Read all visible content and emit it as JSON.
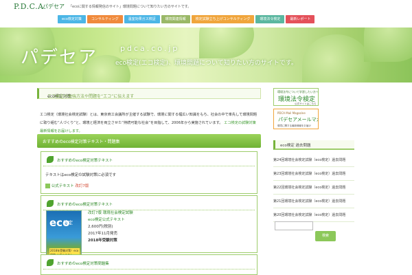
{
  "header": {
    "logo": "P.D.C.A.",
    "logo_sub": "パデセア",
    "tagline": "「ecoに関する情報発信のサイト」環境問題について知りたい方のサイトです。"
  },
  "nav": [
    {
      "label": "eco検定対策",
      "color": "#4cb6e6"
    },
    {
      "label": "コンサルティング",
      "color": "#f08a3c"
    },
    {
      "label": "温室効果ガス検証",
      "color": "#4cb6e6"
    },
    {
      "label": "環境関連情報",
      "color": "#9ab867"
    },
    {
      "label": "検定試験立ち上げコンサルティング",
      "color": "#f0a53c"
    },
    {
      "label": "環境法令検定",
      "color": "#5bb7a0"
    },
    {
      "label": "最新レポート",
      "color": "#e4515a"
    }
  ],
  "hero": {
    "title": "パデセア",
    "domain": "pdca.co.jp",
    "description": "eco検定(エコ検定)、環境問題について知りたい方のサイトです。"
  },
  "page_head": {
    "title": "eco検定対策",
    "rest": "エコ検定の勉強方法や問題を“エコ”に伝えます"
  },
  "intro": {
    "text": "エコ検定（環境社会検定試験）とは、東京商工会議所が主催する試験で、環境に関する幅広い知識をもち、社会の中で率先して環境問題に取り組む“人づくり”と、環境と経済を両立させた“持続可能な社会”を目指して、2006年から実施されています。",
    "link1": "エコ検定の試験対策",
    "link2": "最新情報をお届けします。"
  },
  "section_title": "おすすめのeco検定対策テキスト・問題集",
  "boxes": [
    {
      "title": "おすすめのeco検定対策テキスト",
      "line": "テキストはeco検定の試験対策に必須です",
      "tag": "公式テキスト",
      "tag2": "改訂7版"
    },
    {
      "title": "おすすめのeco検定対策テキスト",
      "book": {
        "name": "改訂7版 環境社会検定試験",
        "sub": "eco検定公式テキスト",
        "price": "2,600円(税別)",
        "date": "2017年11月発売",
        "edition": "2018年受験対策",
        "cover_eco": "eco",
        "cover_ken": "検定",
        "cover_badge": "2018年受験対策！eco検定 公式テキスト"
      }
    },
    {
      "title": "おすすめのeco検定対策問題集"
    }
  ],
  "sidebar": {
    "banner1_small": "環境法令について学習したい方へ",
    "banner1_big": "環境法令検定",
    "banner1_tiny": "公式サイトはこちら",
    "banner2_small": "PDCA Mail Magazine",
    "banner2_big": "パデセアメールマガジン",
    "banner2_tiny": "環境に関する最新情報をお届け",
    "head": "eco検定 過去問題",
    "items": [
      "第24回環境社会検定試験（eco検定）過去問題",
      "第23回環境社会検定試験（eco検定）過去問題",
      "第22回環境社会検定試験（eco検定）過去問題",
      "第21回環境社会検定試験（eco検定）過去問題",
      "第20回環境社会検定試験（eco検定）過去問題"
    ],
    "search_placeholder": "",
    "search_button": "検索"
  }
}
